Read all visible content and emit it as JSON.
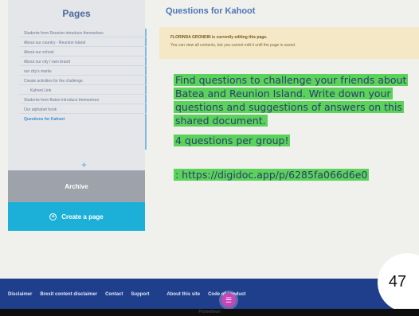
{
  "sidebar": {
    "title": "Pages",
    "items": [
      {
        "label": "Students from Reunion introduce themselves"
      },
      {
        "label": "About our country - Reunion Island"
      },
      {
        "label": "About our school"
      },
      {
        "label": "About our city / own brand"
      },
      {
        "label": "our city's marks"
      },
      {
        "label": "Create activities for the challenge"
      },
      {
        "label": "Kahoot Link"
      },
      {
        "label": "Students from Bateo introduce themselves"
      },
      {
        "label": "Our alphabet book"
      },
      {
        "label": "Questions for Kahoot"
      }
    ],
    "archive_label": "Archive",
    "create_page_label": "Create a page"
  },
  "main": {
    "heading": "Questions for Kahoot",
    "editing_notice_bold": "FLORINDA GRONDIN is currently editing this page.",
    "editing_notice_rest": "You can view all contents, but you cannot edit it until the page is saved.",
    "content": {
      "paragraph1": "Find questions to challenge your friends about Batea and Reunion Island. Write down your questions and suggestions of answers on this shared document.",
      "paragraph2": "4 questions per group!",
      "paragraph3": ": https://digidoc.app/p/6285fa066d6e0"
    }
  },
  "footer": {
    "links": [
      "Disclaimer",
      "Brexit content disclaimer",
      "Contact",
      "Support",
      "About this site",
      "Code of conduct"
    ],
    "menu_icon": "hamburger-icon"
  },
  "overlay_badge": "47",
  "monitor_brand": "Promethean"
}
